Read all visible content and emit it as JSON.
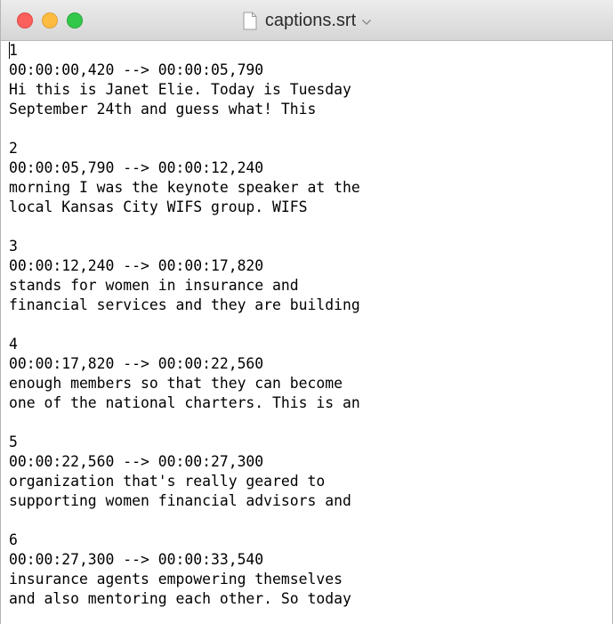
{
  "window": {
    "title": "captions.srt"
  },
  "editor": {
    "lines": [
      "1",
      "00:00:00,420 --> 00:00:05,790",
      "Hi this is Janet Elie. Today is Tuesday",
      "September 24th and guess what! This",
      "",
      "2",
      "00:00:05,790 --> 00:00:12,240",
      "morning I was the keynote speaker at the",
      "local Kansas City WIFS group. WIFS",
      "",
      "3",
      "00:00:12,240 --> 00:00:17,820",
      "stands for women in insurance and",
      "financial services and they are building",
      "",
      "4",
      "00:00:17,820 --> 00:00:22,560",
      "enough members so that they can become",
      "one of the national charters. This is an",
      "",
      "5",
      "00:00:22,560 --> 00:00:27,300",
      "organization that's really geared to",
      "supporting women financial advisors and",
      "",
      "6",
      "00:00:27,300 --> 00:00:33,540",
      "insurance agents empowering themselves",
      "and also mentoring each other. So today"
    ]
  }
}
